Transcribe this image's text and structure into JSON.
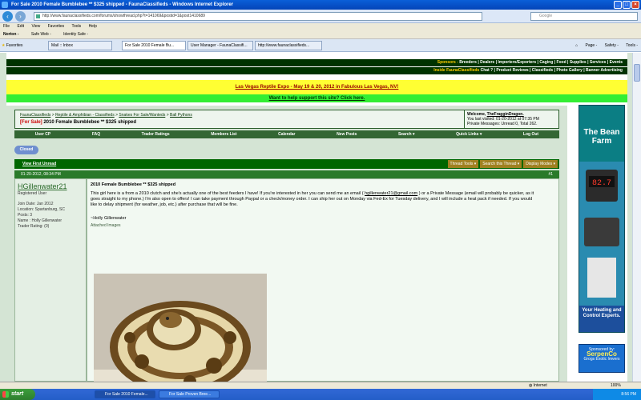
{
  "browser": {
    "title": "For Sale 2010 Female Bumblebee ** $325 shipped - FaunaClassifieds - Windows Internet Explorer",
    "url": "http://www.faunaclassifieds.com/forums/showthread.php?t=141069&postid=1&post1410689",
    "search_placeholder": "Google",
    "menu": [
      "File",
      "Edit",
      "View",
      "Favorites",
      "Tools",
      "Help"
    ],
    "norton": {
      "brand": "Norton -",
      "safe_web": "Safe Web -",
      "identity": "Identity Safe -"
    },
    "favorites_label": "Favorites",
    "tabs": [
      "Mail :: Inbox",
      "For Sale 2010 Female Bu...",
      "User Manager - FaunaClassifi...",
      "http://www.faunaclassifieds..."
    ],
    "tab_tools": [
      "Page -",
      "Safety -",
      "Tools -"
    ],
    "status_zone": "Internet",
    "status_zoom": "100%"
  },
  "site": {
    "sponsors_label": "Sponsors -",
    "sponsor_links": "Breeders | Dealers | Importers/Exporters | Caging | Food | Supplies | Services | Events",
    "inside_label": "Inside FaunaClassifieds",
    "inside_links": "Chat ? | Product Reviews | Classifieds | Photo Gallery | Banner Advertising",
    "expo_link": "Las Vegas Reptile Expo - May 19 & 20, 2012 in Fabulous Las Vegas, NV!",
    "support_link": "Want to help support this site? Click here."
  },
  "forum": {
    "breadcrumb": [
      "FaunaClassifieds",
      "Reptile & Amphibian - Classifieds",
      "Snakes For Sale/Wanteds",
      "Ball Pythons"
    ],
    "thread_tag": "[For Sale]",
    "thread_title": "2010 Female Bumblebee ** $325 shipped",
    "welcome_label": "Welcome,",
    "welcome_user": "TheFragginDragon.",
    "last_visited": "You last visited: 01-20-2012 at 07:35 PM",
    "private_messages": "Private Messages: Unread 0, Total 262.",
    "nav_items": [
      "User CP",
      "FAQ",
      "Trader Ratings",
      "Members List",
      "Calendar",
      "New Posts",
      "Search ▾",
      "Quick Links ▾",
      "Log Out"
    ],
    "closed_label": "Closed",
    "view_first_unread": "View First Unread",
    "thread_tools": [
      "Thread Tools ▾",
      "Search this Thread ▾",
      "Display Modes ▾"
    ],
    "post_date": "01-20-2012, 08:34 PM",
    "post_number": "#1"
  },
  "post": {
    "username": "HGillenwater21",
    "user_role": "Registered User",
    "user_info": [
      "Join Date: Jan 2012",
      "Location: Spartanburg, SC",
      "Posts: 3",
      "Name : Holly Gillenwater",
      "Trader Rating: (0)"
    ],
    "title": "2010 Female Bumblebee ** $325 shipped",
    "body_before_email": "This girl here is a from a 2010 clutch and she's actually one of the best feeders I have! If you're interested in her you can send me an email (",
    "email": "hgillenwater21@gmail.com",
    "body_after_email": ") or a Private Message (email will probably be quicker, as it goes straight to my phone.) I'm also open to offers! I can take payment through Paypal or a check/money order. I can ship her out on Monday via Fed-Ex for Tuesday delivery, and I will include a heat pack if needed. If you would like to delay shipment (for weather, job, etc.) after purchase that will be fine.",
    "signature": "~Holly Gillenwater",
    "attached_label": "Attached Images"
  },
  "ads": {
    "bean_farm": "The Bean Farm",
    "bean_tagline": "Your Heating and Control Experts.",
    "serpenco_label": "Sponsored by:",
    "serpenco_name": "SerpenCo",
    "serpenco_sub": "Grogs Exotic Imvers"
  },
  "taskbar": {
    "start": "start",
    "tasks": [
      "For Sale 2010 Female...",
      "For Sale Proven Bree..."
    ],
    "clock": "8:56 PM"
  }
}
